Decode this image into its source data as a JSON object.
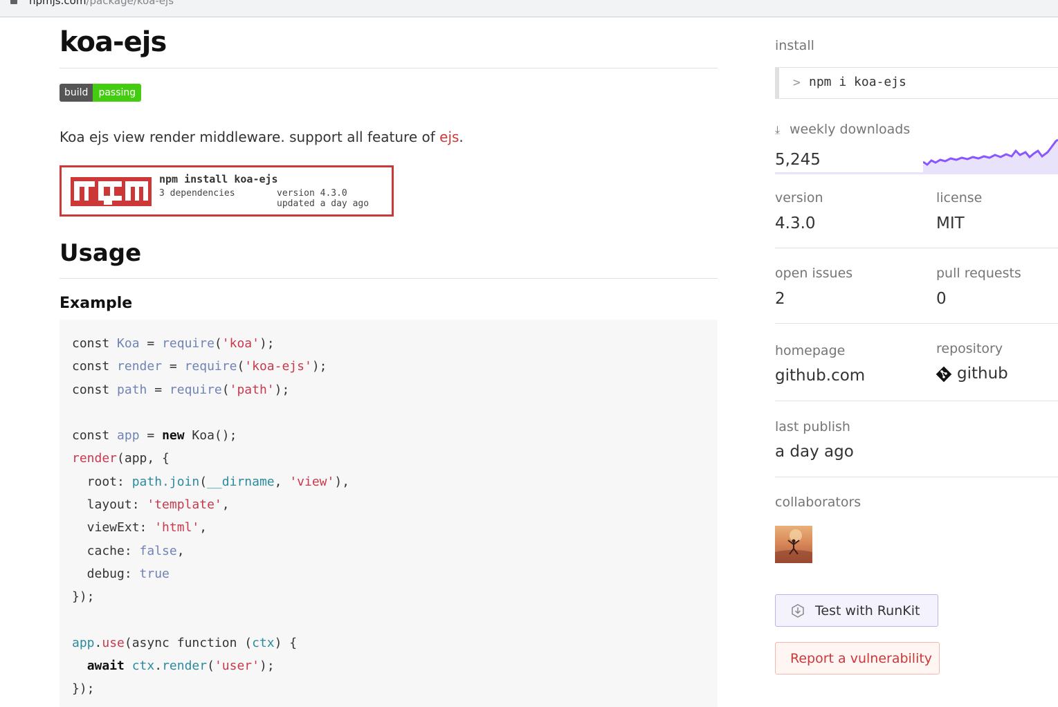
{
  "browser": {
    "url_domain": "npmjs.com",
    "url_path": "/package/koa-ejs"
  },
  "package": {
    "name": "koa-ejs",
    "badge_left": "build",
    "badge_right": "passing",
    "description_prefix": "Koa ejs view render middleware. support all feature of ",
    "description_link": "ejs",
    "description_suffix": "."
  },
  "npm_card": {
    "command": "npm install koa-ejs",
    "dependencies": "3 dependencies",
    "version": "version 4.3.0",
    "updated": "updated a day ago"
  },
  "readme": {
    "usage_heading": "Usage",
    "example_heading": "Example"
  },
  "sidebar": {
    "install_label": "install",
    "install_prompt": ">",
    "install_command": "npm i koa-ejs",
    "weekly_downloads_label": "weekly downloads",
    "weekly_downloads_value": "5,245",
    "version_label": "version",
    "version_value": "4.3.0",
    "license_label": "license",
    "license_value": "MIT",
    "open_issues_label": "open issues",
    "open_issues_value": "2",
    "pull_requests_label": "pull requests",
    "pull_requests_value": "0",
    "homepage_label": "homepage",
    "homepage_value": "github.com",
    "repository_label": "repository",
    "repository_value": "github",
    "last_publish_label": "last publish",
    "last_publish_value": "a day ago",
    "collaborators_label": "collaborators",
    "runkit_label": "Test with RunKit",
    "vulnerability_label": "Report a vulnerability"
  },
  "colors": {
    "npm_red": "#cb3837",
    "badge_green": "#44cc11",
    "sparkline": "#8956ff"
  },
  "icons": [
    "lock-icon",
    "npm-logo",
    "download-icon",
    "github-icon",
    "runkit-icon"
  ]
}
